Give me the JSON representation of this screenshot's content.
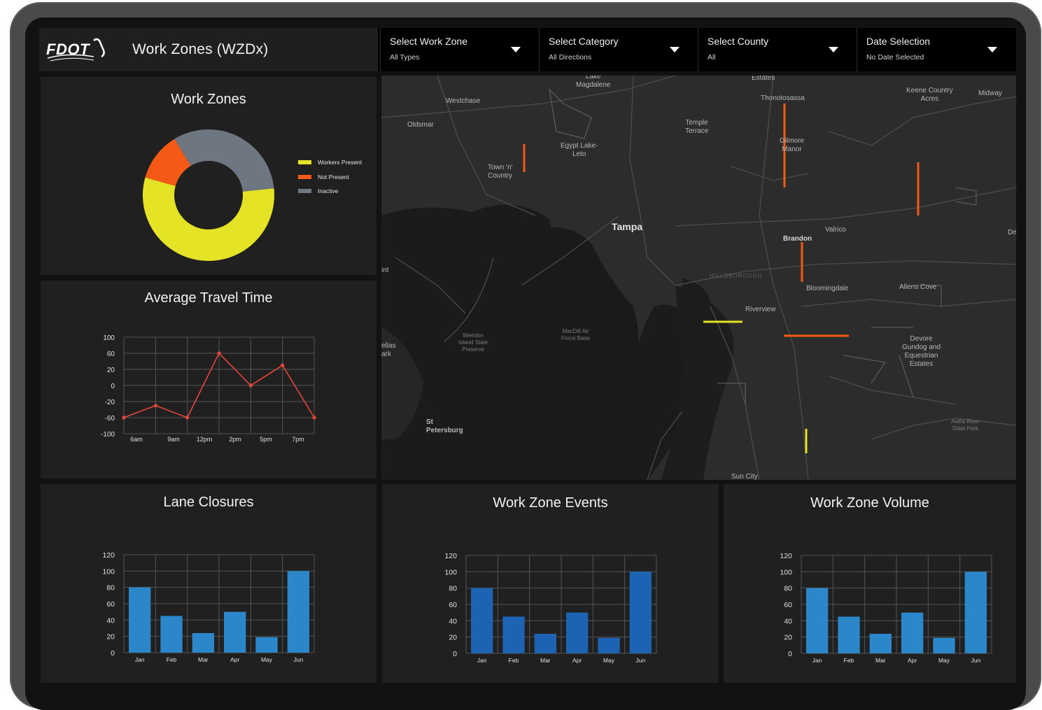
{
  "header": {
    "logo_text": "FDOT",
    "title": "Work Zones (WZDx)"
  },
  "filters": [
    {
      "label": "Select Work Zone",
      "value": "All Types"
    },
    {
      "label": "Select Category",
      "value": "All Directions"
    },
    {
      "label": "Select County",
      "value": "All"
    },
    {
      "label": "Date Selection",
      "value": "No Date Selected"
    }
  ],
  "colors": {
    "workers_present": "#e5e326",
    "not_present": "#f45a15",
    "inactive": "#6e7682",
    "line": "#e5463a",
    "bar_light": "#2b87c9",
    "bar_dark": "#1c63b4"
  },
  "work_zones": {
    "title": "Work Zones",
    "chart_data": {
      "type": "pie",
      "variant": "donut",
      "labels": [
        "Workers Present",
        "Not Present",
        "Inactive"
      ],
      "values": [
        56,
        12,
        32
      ],
      "legend": "right"
    }
  },
  "travel_time": {
    "title": "Average Travel Time",
    "chart_data": {
      "type": "line",
      "x_ticks": [
        "6am",
        "9am",
        "12pm",
        "2pm",
        "5pm",
        "7pm"
      ],
      "values": [
        -60,
        -30,
        -60,
        60,
        0,
        30,
        -60
      ],
      "y_ticks": [
        "100",
        "60",
        "20",
        "0",
        "-20",
        "-60",
        "-100"
      ],
      "grid": true
    }
  },
  "lane_closures": {
    "title": "Lane Closures",
    "chart_data": {
      "type": "bar",
      "categories": [
        "Jan",
        "Feb",
        "Mar",
        "Apr",
        "May",
        "Jun"
      ],
      "values": [
        80,
        45,
        24,
        50,
        19,
        100
      ],
      "y_ticks": [
        "120",
        "100",
        "80",
        "60",
        "40",
        "20",
        "0"
      ],
      "ylim": [
        0,
        120
      ],
      "grid": true
    }
  },
  "events": {
    "title": "Work Zone Events",
    "chart_data": {
      "type": "bar",
      "categories": [
        "Jan",
        "Feb",
        "Mar",
        "Apr",
        "May",
        "Jun"
      ],
      "values": [
        80,
        45,
        24,
        50,
        19,
        100
      ],
      "y_ticks": [
        "120",
        "100",
        "80",
        "60",
        "40",
        "20",
        "0"
      ],
      "ylim": [
        0,
        120
      ],
      "grid": true
    }
  },
  "volume": {
    "title": "Work Zone Volume",
    "chart_data": {
      "type": "bar",
      "categories": [
        "Jan",
        "Feb",
        "Mar",
        "Apr",
        "May",
        "Jun"
      ],
      "values": [
        80,
        45,
        24,
        50,
        19,
        100
      ],
      "y_ticks": [
        "120",
        "100",
        "80",
        "60",
        "40",
        "20",
        "0"
      ],
      "ylim": [
        0,
        120
      ],
      "grid": true
    }
  },
  "map": {
    "labels": {
      "tampa": "Tampa",
      "st_petersburg": "St\nPetersburg",
      "brandon": "Brandon",
      "valrico": "Valrico",
      "riverview": "Riverview",
      "bloomingdale": "Bloomingdale",
      "allens_cove": "Allens Cove",
      "oldsmar": "Oldsmar",
      "westchase": "Westchase",
      "town_n_country": "Town 'n'\nCountry",
      "egypt_lake": "Egypt Lake-\nLeto",
      "temple_terrace": "Temple\nTerrace",
      "thonotosassa": "Thonotosassa",
      "gilmore_manor": "Gilmore\nManor",
      "keene_country": "Keene Country\nAcres",
      "midway": "Midway",
      "lake_magdalene": "Lake\nMagdalene",
      "estates": "Estates",
      "devore": "Devore\nGundog and\nEquestrian\nEstates",
      "sun_city": "Sun City",
      "macdill": "MacDill Air\nForce Base",
      "weedon": "Weedon\nIsland State\nPreserve",
      "hillsborough": "HILLSBOROUGH",
      "alafia": "Alafia River\nState Park",
      "ellas": "ellas\nark",
      "int": "int",
      "de": "De"
    }
  }
}
